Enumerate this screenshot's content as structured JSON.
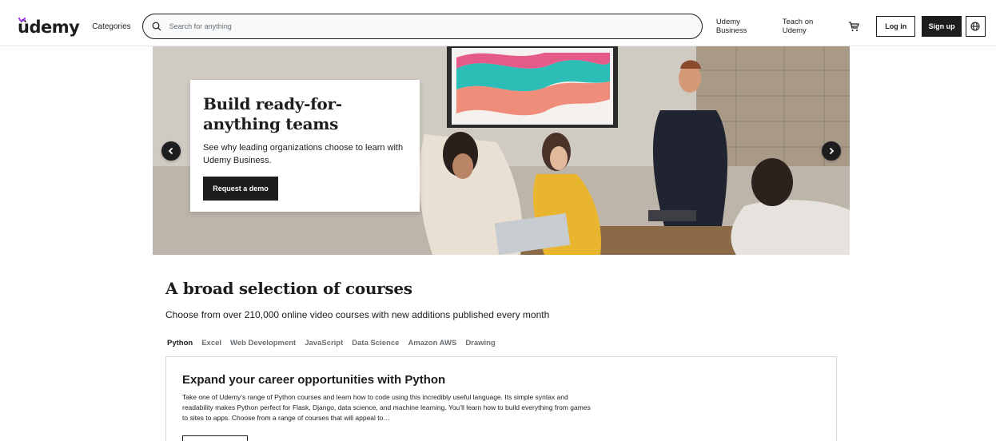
{
  "header": {
    "logo_text": "ûdemy",
    "categories_label": "Categories",
    "search_placeholder": "Search for anything",
    "business_label": "Udemy Business",
    "teach_label": "Teach on Udemy",
    "login_label": "Log in",
    "signup_label": "Sign up"
  },
  "hero": {
    "title": "Build ready-for-anything teams",
    "text": "See why leading organizations choose to learn with Udemy Business.",
    "button_label": "Request a demo"
  },
  "courses": {
    "title": "A broad selection of courses",
    "subtitle": "Choose from over 210,000 online video courses with new additions published every month",
    "tabs": [
      "Python",
      "Excel",
      "Web Development",
      "JavaScript",
      "Data Science",
      "Amazon AWS",
      "Drawing"
    ],
    "active_tab": "Python",
    "panel": {
      "title": "Expand your career opportunities with Python",
      "text": "Take one of Udemy’s range of Python courses and learn how to code using this incredibly useful language. Its simple syntax and readability makes Python perfect for Flask, Django, data science, and machine learning. You’ll learn how to build everything from games to sites to apps. Choose from a range of courses that will appeal to…"
    }
  },
  "icons": {
    "search": "search-icon",
    "cart": "cart-icon",
    "globe": "globe-icon",
    "prev": "chevron-left-icon",
    "next": "chevron-right-icon"
  },
  "colors": {
    "brand_purple": "#a435f0",
    "ink": "#1c1d1f",
    "muted": "#6a6f73",
    "border": "#d1d7dc"
  }
}
